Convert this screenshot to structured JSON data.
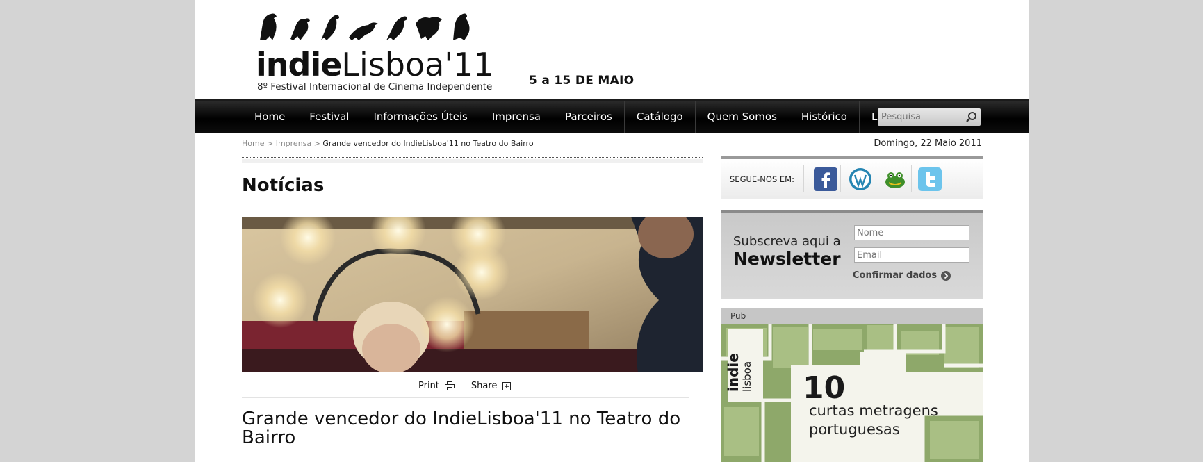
{
  "header": {
    "logo_text_bold": "indie",
    "logo_text_light": "Lisboa'11",
    "logo_subtitle": "8º Festival Internacional de Cinema Independente",
    "dates": "5 a 15 DE MAIO"
  },
  "nav": {
    "items": [
      "Home",
      "Festival",
      "Informações Úteis",
      "Imprensa",
      "Parceiros",
      "Catálogo",
      "Quem Somos",
      "Histórico",
      "Loja"
    ],
    "search_placeholder": "Pesquisa"
  },
  "breadcrumb": {
    "home": "Home",
    "sep1": " > ",
    "section": "Imprensa",
    "sep2": " > ",
    "current": "Grande vencedor do IndieLisboa'11 no Teatro do Bairro"
  },
  "date": "Domingo, 22 Maio 2011",
  "main": {
    "section_title": "Notícias",
    "actions": {
      "print": "Print",
      "share": "Share"
    },
    "headline": "Grande vencedor do IndieLisboa'11 no Teatro do Bairro"
  },
  "sidebar": {
    "follow_label": "SEGUE-NOS EM:",
    "social_icons": [
      "facebook-icon",
      "wordpress-icon",
      "frog-icon",
      "twitter-icon"
    ],
    "newsletter": {
      "line1": "Subscreva aqui a",
      "line2": "Newsletter",
      "name_placeholder": "Nome",
      "email_placeholder": "Email",
      "confirm": "Confirmar dados"
    },
    "pub": {
      "label": "Pub",
      "number": "10",
      "line1": "curtas metragens",
      "line2": "portuguesas"
    }
  },
  "colors": {
    "page_background": "#d4d4d4",
    "nav_background": "#000000",
    "sidebar_panel": "#cfcfcf"
  }
}
